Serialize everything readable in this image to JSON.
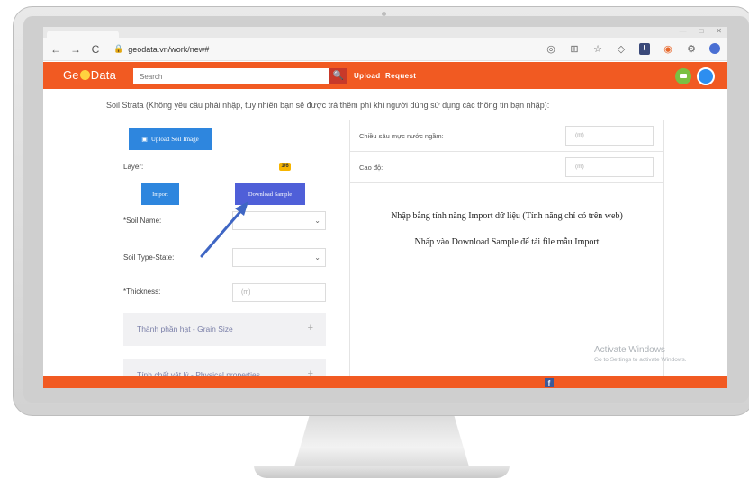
{
  "browser": {
    "url": "geodata.vn/work/new#",
    "nav": {
      "back_icon": "←",
      "forward_icon": "→",
      "reload_icon": "C",
      "lock_icon": "🔒"
    },
    "window_buttons": [
      "—",
      "□",
      "✕"
    ],
    "extension_icons": [
      "location-icon",
      "translate-icon",
      "star-icon",
      "shield-icon",
      "download-icon",
      "circle-extension-icon",
      "puzzle-icon",
      "profile-avatar-icon"
    ]
  },
  "header": {
    "logo_left": "Ge",
    "logo_right": "Data",
    "search_placeholder": "Search",
    "search_icon": "🔍",
    "nav_upload": "Upload",
    "nav_request": "Request",
    "accent_color": "#f15a22"
  },
  "section": {
    "title": "Soil Strata (Không yêu cầu phải nhập, tuy nhiên bạn sẽ được trả thêm phí khi người dùng sử dụng các thông tin bạn nhập):"
  },
  "left_panel": {
    "upload_image_label": "Upload Soil Image",
    "layer_label": "Layer:",
    "layer_badge": "1/6",
    "import_label": "Import",
    "download_sample_label": "Download Sample",
    "soil_name_label": "*Soil Name:",
    "soil_type_label": "Soil Type-State:",
    "thickness_label": "*Thickness:",
    "thickness_placeholder": "(m)",
    "grain_size_label": "Thành phần hạt - Grain Size",
    "physical_label": "Tính chất vật lý - Physical properties",
    "plus": "+",
    "chevron": "⌄"
  },
  "right_panel": {
    "groundwater_label": "Chiều sâu mực nước ngầm:",
    "groundwater_placeholder": "(m)",
    "elevation_label": "Cao độ:",
    "elevation_placeholder": "(m)",
    "message_1": "Nhập bằng tính năng Import dữ liệu (Tính năng chỉ có trên web)",
    "message_2": "Nhấp vào Download Sample để tải file mẫu Import"
  },
  "watermark": {
    "line1": "Activate Windows",
    "line2": "Go to Settings to activate Windows."
  },
  "footer": {
    "facebook_icon": "f"
  }
}
